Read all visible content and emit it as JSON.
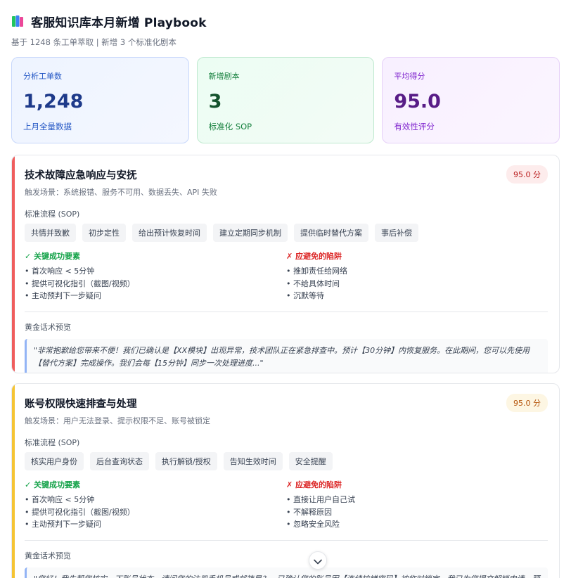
{
  "header": {
    "title": "客服知识库本月新增 Playbook",
    "subtitle": "基于 1248 条工单萃取 | 新增 3 个标准化剧本",
    "icon": "books-icon"
  },
  "stats": [
    {
      "label": "分析工单数",
      "value": "1,248",
      "note": "上月全量数据",
      "color": "#1e3a8a"
    },
    {
      "label": "新增剧本",
      "value": "3",
      "note": "标准化 SOP",
      "color": "#14532d"
    },
    {
      "label": "平均得分",
      "value": "95.0",
      "note": "有效性评分",
      "color": "#581c87"
    }
  ],
  "playbooks": [
    {
      "title": "技术故障应急响应与安抚",
      "score": "95.0 分",
      "trigger": "触发场景：系统报错、服务不可用、数据丢失、API 失败",
      "sop_label": "标准流程 (SOP)",
      "steps": [
        "共情并致歉",
        "初步定性",
        "给出预计恢复时间",
        "建立定期同步机制",
        "提供临时替代方案",
        "事后补偿"
      ],
      "success_label": "✓ 关键成功要素",
      "success": [
        "首次响应 < 5分钟",
        "提供可视化指引（截图/视频）",
        "主动预判下一步疑问"
      ],
      "pitfall_label": "✗ 应避免的陷阱",
      "pitfalls": [
        "推卸责任给网络",
        "不给具体时间",
        "沉默等待"
      ],
      "golden_label": "黄金话术预览",
      "quote": "\"非常抱歉给您带来不便！我们已确认是【XX模块】出现异常，技术团队正在紧急排查中。预计【30分钟】内恢复服务。在此期间，您可以先使用【替代方案】完成操作。我们会每【15分钟】同步一次处理进度...\"",
      "accent": "#ef5d5d"
    },
    {
      "title": "账号权限快速排查与处理",
      "score": "95.0 分",
      "trigger": "触发场景：用户无法登录、提示权限不足、账号被锁定",
      "sop_label": "标准流程 (SOP)",
      "steps": [
        "核实用户身份",
        "后台查询状态",
        "执行解锁/授权",
        "告知生效时间",
        "安全提醒"
      ],
      "success_label": "✓ 关键成功要素",
      "success": [
        "首次响应 < 5分钟",
        "提供可视化指引（截图/视频）",
        "主动预判下一步疑问"
      ],
      "pitfall_label": "✗ 应避免的陷阱",
      "pitfalls": [
        "直接让用户自己试",
        "不解释原因",
        "忽略安全风险"
      ],
      "golden_label": "黄金话术预览",
      "quote": "\"您好！我先帮您核实一下账号状态。请问您的注册手机号或邮箱是？...已确认您的账号因【连续输错密码】被临时锁定。我已为您提交解锁申请，预计【5分钟】内生效。生效后您即可正常登录...\"",
      "accent": "#f5c433"
    }
  ]
}
